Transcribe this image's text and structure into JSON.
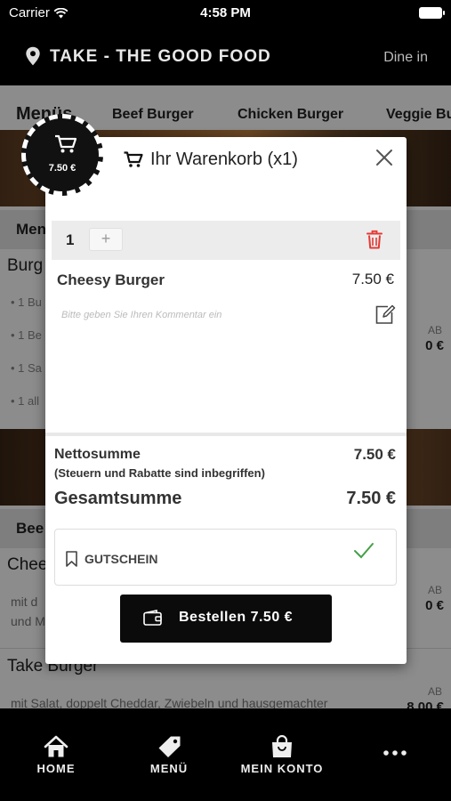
{
  "status_bar": {
    "carrier": "Carrier",
    "time": "4:58 PM"
  },
  "header": {
    "title": "TAKE - THE GOOD FOOD",
    "dine_in": "Dine in",
    "location_icon": "map-pin-icon"
  },
  "background": {
    "tabs": [
      "Menüs",
      "Beef Burger",
      "Chicken Burger",
      "Veggie Bu"
    ],
    "section1_title": "Men",
    "item1_title": "Burg",
    "item1_bullets": [
      "• 1 Bu",
      "• 1 Be",
      "• 1 Sa",
      "• 1 all"
    ],
    "ab_label": "AB",
    "price_fragment": "0 €",
    "section2_title": "Bee",
    "item2_title": "Chee",
    "item2_desc": [
      "mit d",
      "und M"
    ],
    "item3_title": "Take Burger",
    "item3_desc": "mit Salat, doppelt Cheddar, Zwiebeln und hausgemachter",
    "item3_price": "8.00 €"
  },
  "cart_badge": {
    "amount": "7.50 €",
    "icon": "cart-icon"
  },
  "cart": {
    "title": "Ihr Warenkorb (x1)",
    "quantity": "1",
    "plus_label": "+",
    "product_name": "Cheesy Burger",
    "product_price": "7.50 €",
    "comment_placeholder": "Bitte geben Sie Ihren Kommentar ein",
    "net_label": "Nettosumme",
    "net_value": "7.50 €",
    "tax_note": "(Steuern und Rabatte sind inbegriffen)",
    "total_label": "Gesamtsumme",
    "total_value": "7.50 €",
    "voucher_label": "GUTSCHEIN",
    "order_button": "Bestellen 7.50 €"
  },
  "tab_bar": {
    "items": [
      {
        "label": "HOME",
        "icon": "home-icon"
      },
      {
        "label": "MENÜ",
        "icon": "tag-icon"
      },
      {
        "label": "MEIN KONTO",
        "icon": "shopping-bag-icon"
      },
      {
        "label": "",
        "icon": "more-icon"
      }
    ]
  },
  "colors": {
    "accent": "#000000",
    "trash": "#e53935",
    "check": "#43a047"
  }
}
